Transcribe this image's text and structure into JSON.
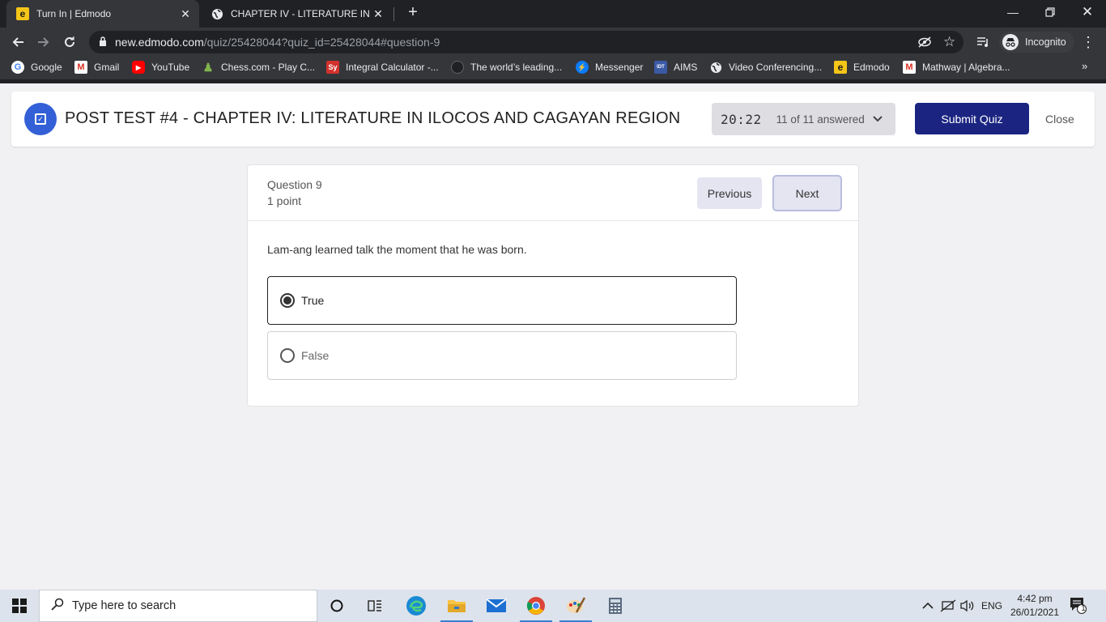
{
  "browser": {
    "tabs": [
      {
        "title": "Turn In | Edmodo",
        "favicon": "edmodo-icon",
        "active": true
      },
      {
        "title": "CHAPTER IV - LITERATURE IN ILO",
        "favicon": "globe-icon",
        "active": false
      }
    ],
    "url_host": "new.edmodo.com",
    "url_path": "/quiz/25428044?quiz_id=25428044#question-9",
    "profile_label": "Incognito",
    "bookmarks": [
      {
        "label": "Google",
        "icon": "google-icon"
      },
      {
        "label": "Gmail",
        "icon": "gmail-icon"
      },
      {
        "label": "YouTube",
        "icon": "youtube-icon"
      },
      {
        "label": "Chess.com - Play C...",
        "icon": "chess-icon"
      },
      {
        "label": "Integral Calculator -...",
        "icon": "symbolab-icon"
      },
      {
        "label": "The world’s leading...",
        "icon": "github-icon"
      },
      {
        "label": "Messenger",
        "icon": "messenger-icon"
      },
      {
        "label": "AIMS",
        "icon": "aims-icon"
      },
      {
        "label": "Video Conferencing...",
        "icon": "globe-icon"
      },
      {
        "label": "Edmodo",
        "icon": "edmodo-icon"
      },
      {
        "label": "Mathway | Algebra...",
        "icon": "mathway-icon"
      }
    ],
    "bookmarks_more": "»"
  },
  "quiz": {
    "title": "POST TEST #4 - CHAPTER IV: LITERATURE IN ILOCOS AND CAGAYAN REGION",
    "timer": "20:22",
    "answered": "11 of 11 answered",
    "submit_label": "Submit Quiz",
    "close_label": "Close"
  },
  "question": {
    "number_label": "Question 9",
    "points_label": "1 point",
    "previous_label": "Previous",
    "next_label": "Next",
    "text": "Lam-ang learned talk the moment that he was born.",
    "options": [
      {
        "label": "True",
        "selected": true
      },
      {
        "label": "False",
        "selected": false
      }
    ]
  },
  "taskbar": {
    "search_placeholder": "Type here to search",
    "language": "ENG",
    "time": "4:42 pm",
    "date": "26/01/2021",
    "notification_count": "1"
  },
  "colors": {
    "primary": "#1b2581",
    "logo": "#3360d6",
    "chrome_dark": "#202124",
    "chrome_toolbar": "#35363a"
  }
}
